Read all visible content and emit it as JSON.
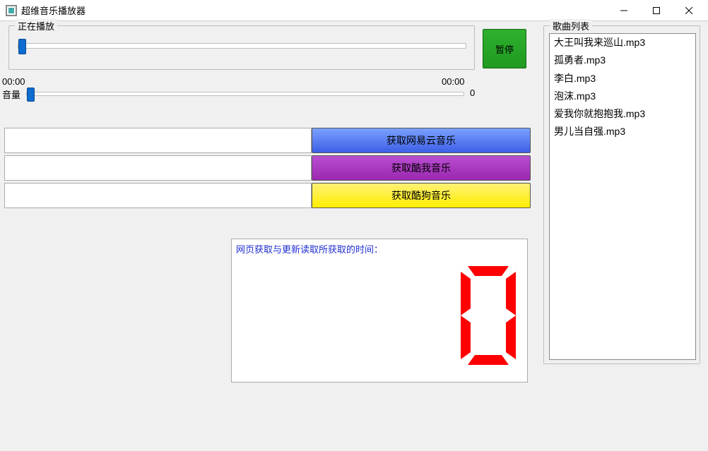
{
  "window": {
    "title": "超维音乐播放器"
  },
  "now_playing": {
    "legend": "正在播放",
    "time_elapsed": "00:00",
    "time_total": "00:00",
    "progress_percent": 0
  },
  "pause_button": {
    "label": "暂停"
  },
  "volume": {
    "label": "音量",
    "value": "0",
    "percent": 0
  },
  "sources": [
    {
      "value": "",
      "button_label": "获取网易云音乐",
      "color": "blue"
    },
    {
      "value": "",
      "button_label": "获取酷我音乐",
      "color": "purple"
    },
    {
      "value": "",
      "button_label": "获取酷狗音乐",
      "color": "yellow"
    }
  ],
  "timer_panel": {
    "caption": "网页获取与更新读取所获取的时间：",
    "digit": "0"
  },
  "playlist": {
    "legend": "歌曲列表",
    "items": [
      "大王叫我来巡山.mp3",
      "孤勇者.mp3",
      "李白.mp3",
      "泡沫.mp3",
      "爱我你就抱抱我.mp3",
      "男儿当自强.mp3"
    ]
  }
}
